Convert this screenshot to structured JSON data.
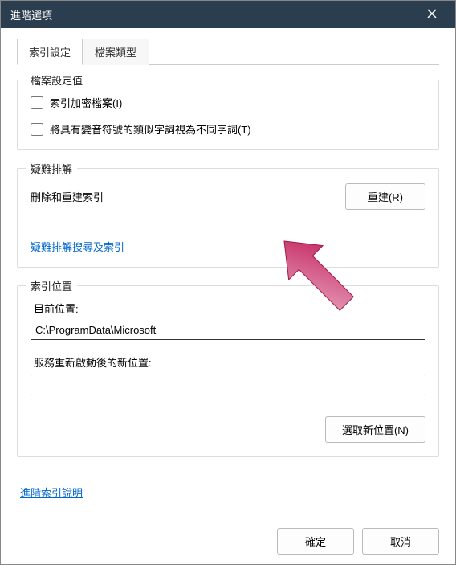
{
  "titlebar": {
    "title": "進階選項"
  },
  "tabs": [
    {
      "label": "索引設定",
      "active": true
    },
    {
      "label": "檔案類型",
      "active": false
    }
  ],
  "groups": {
    "file_settings": {
      "title": "檔案設定值",
      "encrypt_label": "索引加密檔案(I)",
      "diacritics_label": "將具有變音符號的類似字詞視為不同字詞(T)"
    },
    "troubleshoot": {
      "title": "疑難排解",
      "rebuild_text": "刪除和重建索引",
      "rebuild_button": "重建(R)",
      "help_link": "疑難排解搜尋及索引"
    },
    "location": {
      "title": "索引位置",
      "current_label": "目前位置:",
      "current_value": "C:\\ProgramData\\Microsoft",
      "new_label": "服務重新啟動後的新位置:",
      "new_value": "",
      "select_button": "選取新位置(N)"
    }
  },
  "footer": {
    "advanced_link": "進階索引說明",
    "ok": "確定",
    "cancel": "取消"
  }
}
